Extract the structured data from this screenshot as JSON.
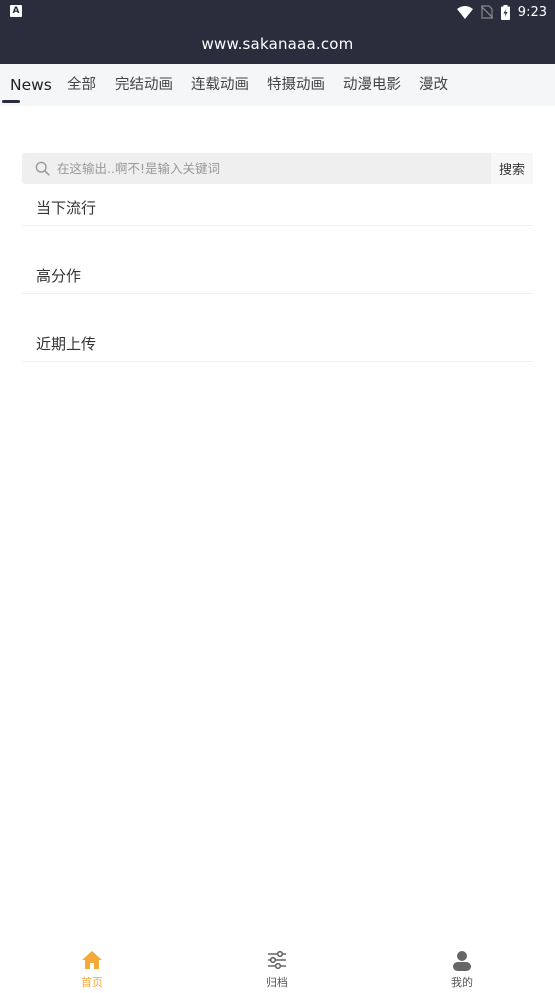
{
  "status_bar": {
    "left_badge": "A",
    "time": "9:23",
    "icons": [
      "wifi-icon",
      "no-sim-icon",
      "battery-icon"
    ]
  },
  "url_bar": {
    "url": "www.sakanaaa.com"
  },
  "tabs": [
    {
      "label": "News",
      "active": true
    },
    {
      "label": "全部"
    },
    {
      "label": "完结动画"
    },
    {
      "label": "连载动画"
    },
    {
      "label": "特摄动画"
    },
    {
      "label": "动漫电影"
    },
    {
      "label": "漫改"
    }
  ],
  "search": {
    "placeholder": "在这输出..啊不!是输入关键词",
    "button_label": "搜索",
    "icon": "search-icon"
  },
  "sections": [
    {
      "title": "当下流行"
    },
    {
      "title": "高分作"
    },
    {
      "title": "近期上传"
    }
  ],
  "bottom_nav": [
    {
      "label": "首页",
      "icon": "home-icon",
      "active": true
    },
    {
      "label": "归档",
      "icon": "sliders-icon"
    },
    {
      "label": "我的",
      "icon": "user-icon"
    }
  ],
  "colors": {
    "header_bg": "#2b2d3d",
    "tab_bg": "#f5f6f8",
    "accent": "#f4a93b"
  }
}
